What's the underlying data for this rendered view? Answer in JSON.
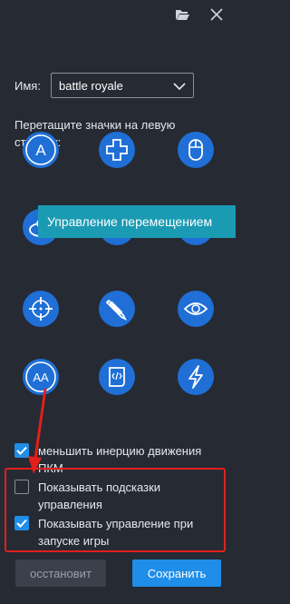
{
  "titlebar": {
    "open_icon": "folder-open-icon",
    "close_icon": "close-icon"
  },
  "name": {
    "label": "Имя:",
    "value": "battle royale"
  },
  "instructions": "Перетащите значки на левую сторону:",
  "tooltip": "Управление перемещением",
  "icons": [
    "letter-a-key-icon",
    "dpad-icon",
    "mouse-icon",
    "movement-icon",
    "hat-icon",
    "sword-icon",
    "crosshair-icon",
    "pencil-icon",
    "eye-icon",
    "double-a-icon",
    "script-icon",
    "lightning-icon"
  ],
  "options": {
    "reduce_inertia": {
      "label": "меньшить инерцию движения ПКМ",
      "checked": true
    },
    "show_hints": {
      "label": "Показывать подсказки управления",
      "checked": false
    },
    "show_on_launch": {
      "label": "Показывать управление при запуске игры",
      "checked": true
    }
  },
  "buttons": {
    "reset": "осстановит",
    "save": "Сохранить"
  },
  "colors": {
    "background": "#262a33",
    "accent": "#1f8ee8",
    "icon": "#1f6fd6",
    "tooltip": "#1b9ab3",
    "annotation": "#e0201b"
  }
}
